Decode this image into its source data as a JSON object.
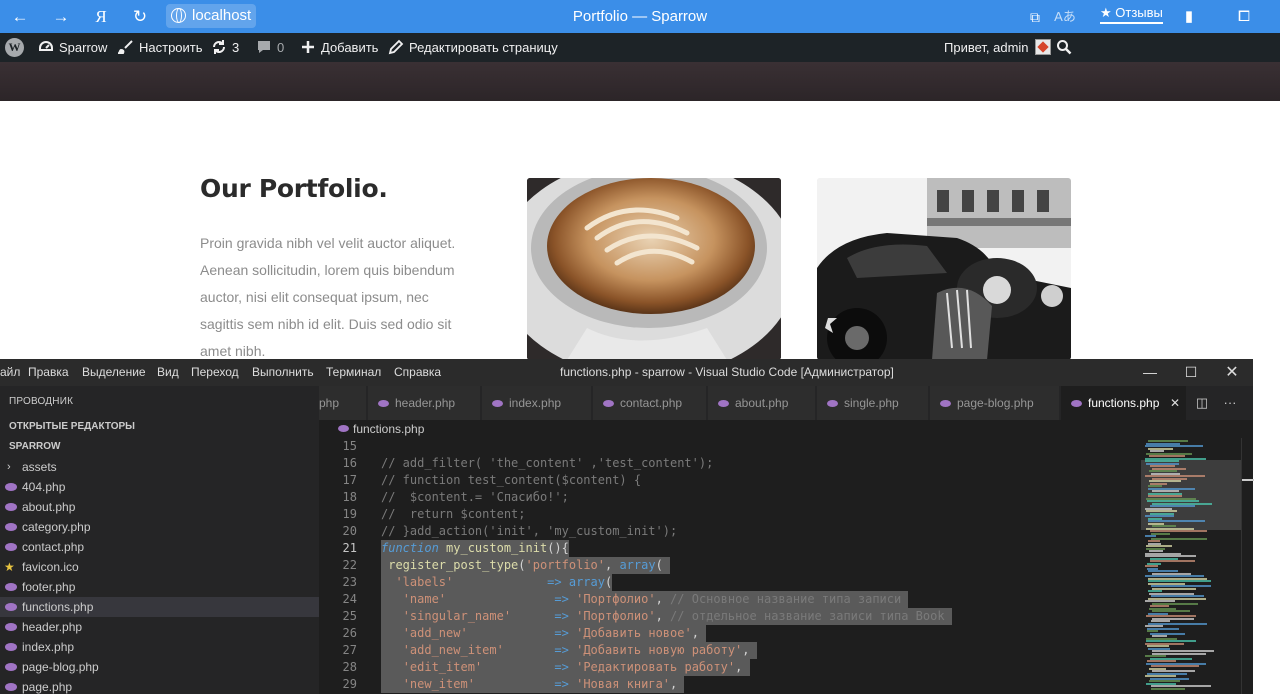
{
  "browser": {
    "url": "localhost",
    "title": "Portfolio — Sparrow",
    "reviews_label": "★ Отзывы",
    "yandex_label": "Я"
  },
  "admin_bar": {
    "site_name": "Sparrow",
    "customize": "Настроить",
    "updates_count": "3",
    "comments_count": "0",
    "add_new": "Добавить",
    "edit_page": "Редактировать страницу",
    "greeting": "Привет, admin"
  },
  "portfolio": {
    "title": "Our Portfolio.",
    "text": "Proin gravida nibh vel velit auctor aliquet. Aenean sollicitudin, lorem quis bibendum auctor, nisi elit consequat ipsum, nec sagittis sem nibh id elit. Duis sed odio sit amet nibh."
  },
  "vscode": {
    "menu": [
      "айл",
      "Правка",
      "Выделение",
      "Вид",
      "Переход",
      "Выполнить",
      "Терминал",
      "Справка"
    ],
    "window_title": "functions.php - sparrow - Visual Studio Code [Администратор]",
    "explorer_label": "ПРОВОДНИК",
    "open_editors": "ОТКРЫТЫЕ РЕДАКТОРЫ",
    "project": "SPARROW",
    "files": [
      "assets",
      "404.php",
      "about.php",
      "category.php",
      "contact.php",
      "favicon.ico",
      "footer.php",
      "functions.php",
      "header.php",
      "index.php",
      "page-blog.php",
      "page.php"
    ],
    "tabs": [
      "php",
      "header.php",
      "index.php",
      "contact.php",
      "about.php",
      "single.php",
      "page-blog.php",
      "functions.php"
    ],
    "breadcrumb": "functions.php",
    "line_numbers": [
      "15",
      "16",
      "17",
      "18",
      "19",
      "20",
      "21",
      "22",
      "23",
      "24",
      "25",
      "26",
      "27",
      "28",
      "29"
    ]
  }
}
